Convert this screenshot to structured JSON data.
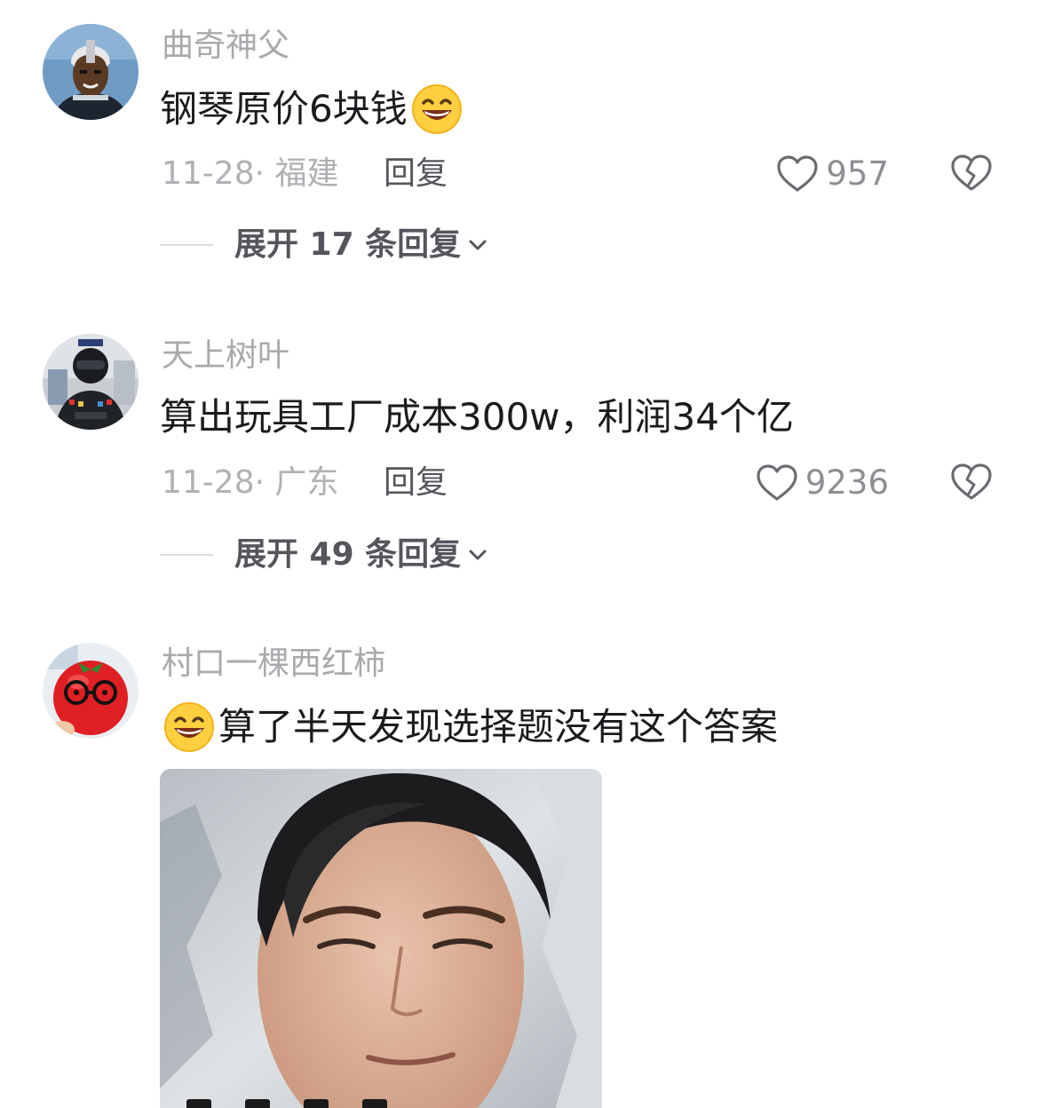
{
  "comments": [
    {
      "username": "曲奇神父",
      "text": "钢琴原价6块钱",
      "date_location": "11-28· 福建",
      "reply_label": "回复",
      "likes": "957",
      "expand_label": "展开 17 条回复",
      "avatar_icon": "avatar-helmet-character",
      "emoji": "grinning-emoji"
    },
    {
      "username": "天上树叶",
      "text": "算出玩具工厂成本300w，利润34个亿",
      "date_location": "11-28· 广东",
      "reply_label": "回复",
      "likes": "9236",
      "expand_label": "展开 49 条回复",
      "avatar_icon": "avatar-soldier"
    },
    {
      "username": "村口一棵西红柿",
      "text": "算了半天发现选择题没有这个答案",
      "avatar_icon": "avatar-tomato-with-glasses",
      "emoji": "grinning-emoji",
      "image_icon": "meme-face-photo"
    }
  ],
  "colors": {
    "username": "#a9a9ae",
    "content": "#1b1b1f",
    "meta": "#b0b0b5",
    "action": "#55555c",
    "icon": "#6b6b72"
  }
}
